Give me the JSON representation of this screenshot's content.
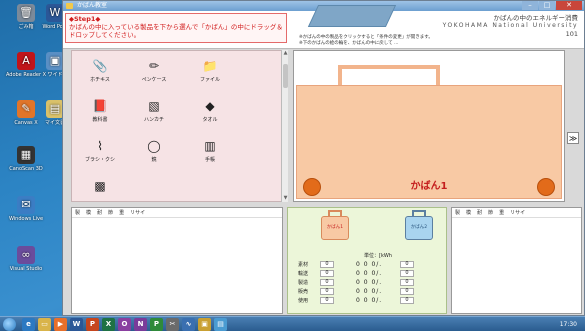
{
  "desktop": {
    "icons": [
      {
        "label": "ごみ箱",
        "icon": "recycle-bin-icon"
      },
      {
        "label": "Word Po...",
        "icon": "word-doc-icon"
      },
      {
        "label": "Adobe Reader X",
        "icon": "adobe-reader-icon"
      },
      {
        "label": "ワイド",
        "icon": "shortcut-icon"
      },
      {
        "label": "Canvas X",
        "icon": "canvas-icon"
      },
      {
        "label": "マイ文書",
        "icon": "documents-icon"
      },
      {
        "label": "CanoScan 3D",
        "icon": "scanner-icon"
      },
      {
        "label": "Windows Live",
        "icon": "windows-live-icon"
      },
      {
        "label": "Visual Studio",
        "icon": "visual-studio-icon"
      }
    ]
  },
  "window": {
    "title": "かばん教室"
  },
  "header": {
    "step_title": "◆Step1◆",
    "instruction": "かばんの中に入っている製品を下から選んで「かばん」の中にドラッグ＆ドロップしてください。",
    "app_title": "かばんの中のエネルギー消費",
    "university": "YOKOHAMA National University",
    "year": "101",
    "note1": "※かばんの中の製品をクリックすると「条件の変更」が開きます。",
    "note2": "※下のかばんの絵の輪を、かばんの中に戻して ..."
  },
  "palette": {
    "items": [
      {
        "label": "ホチキス",
        "icon": "stapler-icon"
      },
      {
        "label": "ペンケース",
        "icon": "pen-case-icon"
      },
      {
        "label": "ファイル",
        "icon": "file-icon"
      },
      {
        "label": "教科書",
        "icon": "textbook-icon"
      },
      {
        "label": "ハンカチ",
        "icon": "handkerchief-icon"
      },
      {
        "label": "タオル",
        "icon": "towel-icon"
      },
      {
        "label": "ブラシ・クシ",
        "icon": "brush-icon"
      },
      {
        "label": "鏡",
        "icon": "mirror-icon"
      },
      {
        "label": "手帳",
        "icon": "notebook-icon"
      }
    ]
  },
  "bag": {
    "label": "かばん1",
    "next_label": "≫"
  },
  "panels": {
    "headers": [
      "製",
      "模",
      "耐",
      "節",
      "重",
      "リサイ"
    ]
  },
  "compare": {
    "bag1_label": "かばん1",
    "bag2_label": "かばん2",
    "units": "単位：[kWh",
    "rows": [
      {
        "label": "素材",
        "value": "0",
        "mid": "0 0 0/.",
        "value2": "0"
      },
      {
        "label": "輸送",
        "value": "0",
        "mid": "0 0 0/.",
        "value2": "0"
      },
      {
        "label": "製造",
        "value": "0",
        "mid": "0 0 0/.",
        "value2": "0"
      },
      {
        "label": "販売",
        "value": "0",
        "mid": "0 0 0/.",
        "value2": "0"
      },
      {
        "label": "使用",
        "value": "0",
        "mid": "0 0 0/.",
        "value2": "0"
      }
    ]
  },
  "taskbar": {
    "time": "17:30"
  },
  "colors": {
    "accent": "#d21d1d",
    "bag": "#f8c9a4",
    "wheel": "#e26b1a",
    "palette_bg": "#f6e3e5"
  }
}
